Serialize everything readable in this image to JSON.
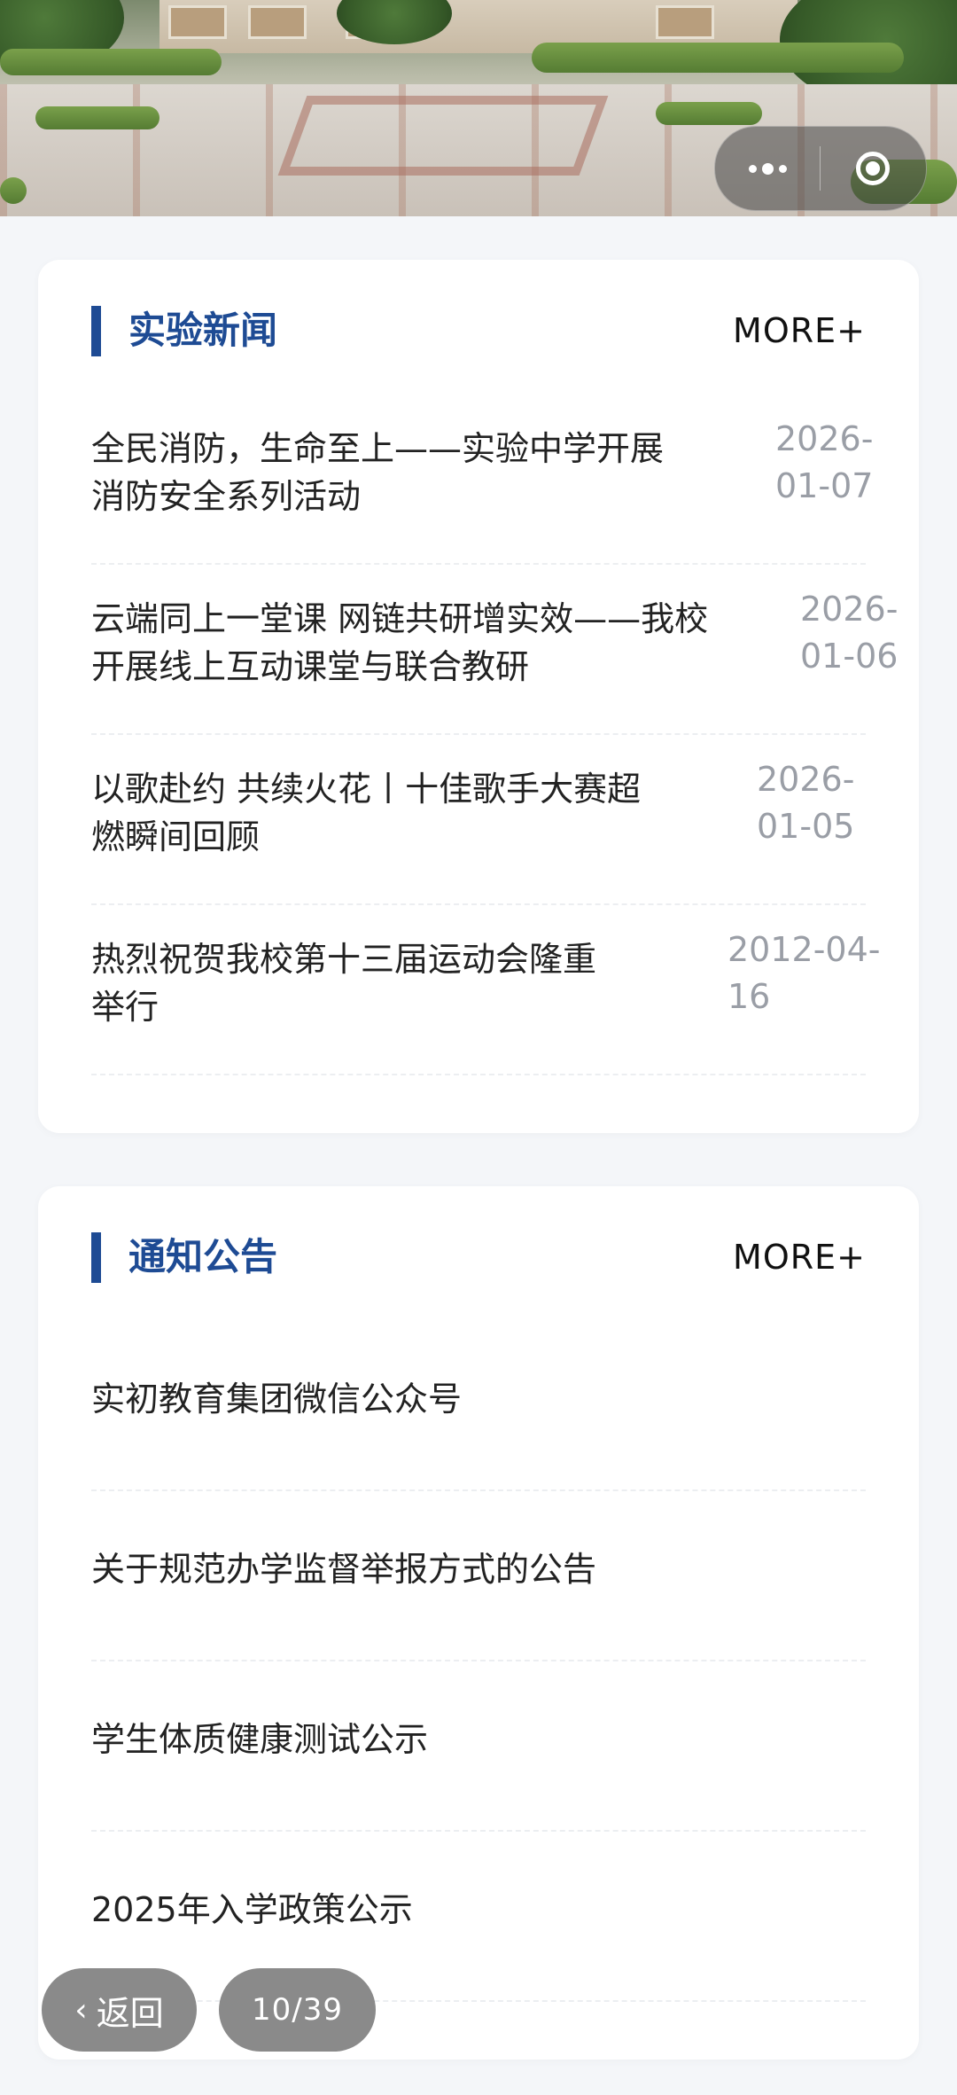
{
  "header": {
    "menu_icon": "more-dots-icon",
    "close_icon": "target-circle-icon"
  },
  "news": {
    "title": "实验新闻",
    "more_label": "MORE+",
    "items": [
      {
        "line1": "全民消防，生命至上——实验中学开展",
        "line2": "消防安全系列活动",
        "date_line1": "2026-",
        "date_line2": "01-07"
      },
      {
        "line1": "云端同上一堂课 网链共研增实效——我校",
        "line2": "开展线上互动课堂与联合教研",
        "date_line1": "2026-",
        "date_line2": "01-06"
      },
      {
        "line1": "以歌赴约 共续火花丨十佳歌手大赛超",
        "line2": "燃瞬间回顾",
        "date_line1": "2026-",
        "date_line2": "01-05"
      },
      {
        "line1": "热烈祝贺我校第十三届运动会隆重",
        "line2": "举行",
        "date_line1": "2012-04-",
        "date_line2": "16"
      }
    ]
  },
  "notice": {
    "title": "通知公告",
    "more_label": "MORE+",
    "items": [
      {
        "text": "实初教育集团微信公众号"
      },
      {
        "text": "关于规范办学监督举报方式的公告"
      },
      {
        "text": "学生体质健康测试公示"
      },
      {
        "text": "2025年入学政策公示"
      }
    ]
  },
  "footer": {
    "back_label": "返回",
    "back_icon": "chevron-left-icon",
    "page_indicator": "10/39"
  }
}
